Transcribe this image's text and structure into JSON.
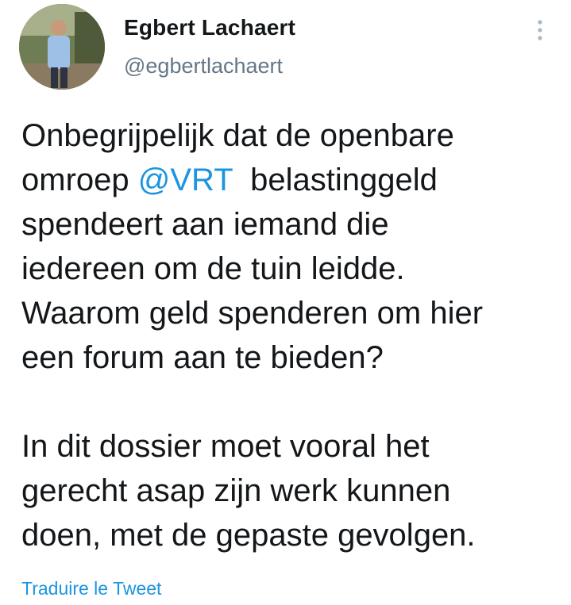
{
  "author": {
    "display_name": "Egbert Lachaert",
    "handle": "@egbertlachaert"
  },
  "tweet": {
    "paragraph1_lines": [
      {
        "before": "Onbegrijpelijk dat de openbare",
        "mention": "",
        "after": ""
      },
      {
        "before": "omroep ",
        "mention": "@VRT",
        "after": "  belastinggeld"
      },
      {
        "before": "spendeert aan iemand die",
        "mention": "",
        "after": ""
      },
      {
        "before": "iedereen om de tuin leidde.",
        "mention": "",
        "after": ""
      },
      {
        "before": "Waarom geld spenderen om hier",
        "mention": "",
        "after": ""
      },
      {
        "before": "een forum aan te bieden?",
        "mention": "",
        "after": ""
      }
    ],
    "paragraph2_lines": [
      "In dit dossier moet vooral het",
      "gerecht asap zijn werk kunnen",
      "doen, met de gepaste gevolgen."
    ]
  },
  "translate_label": "Traduire le Tweet",
  "icons": {
    "more": "more-vertical-icon",
    "avatar": "profile-photo"
  },
  "colors": {
    "text": "#14171a",
    "secondary": "#657786",
    "link": "#1b95e0"
  }
}
